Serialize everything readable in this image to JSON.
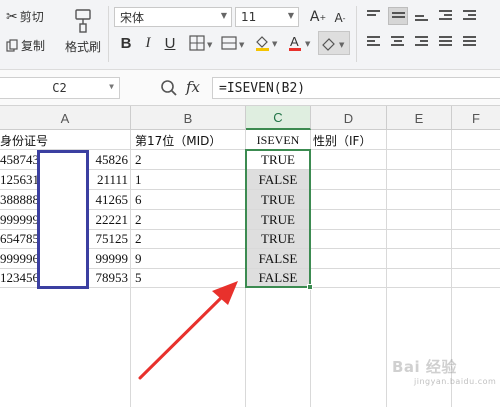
{
  "ribbon": {
    "cut_label": "剪切",
    "copy_label": "复制",
    "format_painter_label": "格式刷",
    "font_name": "宋体",
    "font_size": "11",
    "bold": "B",
    "italic": "I",
    "underline": "U"
  },
  "formula_bar": {
    "name_box": "C2",
    "fx": "fx",
    "formula": "=ISEVEN(B2)"
  },
  "columns": [
    "A",
    "B",
    "C",
    "D",
    "E",
    "F"
  ],
  "selected_column": "C",
  "table": {
    "headers": {
      "a": "身份证号",
      "b": "第17位（MID）",
      "c": "ISEVEN",
      "d": "性别（IF）"
    },
    "rows": [
      {
        "a_left": "458743",
        "a_right": "45826",
        "b": "2",
        "c": "TRUE"
      },
      {
        "a_left": "125631",
        "a_right": "21111",
        "b": "1",
        "c": "FALSE"
      },
      {
        "a_left": "388888",
        "a_right": "41265",
        "b": "6",
        "c": "TRUE"
      },
      {
        "a_left": "999999",
        "a_right": "22221",
        "b": "2",
        "c": "TRUE"
      },
      {
        "a_left": "654785",
        "a_right": "75125",
        "b": "2",
        "c": "TRUE"
      },
      {
        "a_left": "999996",
        "a_right": "99999",
        "b": "9",
        "c": "FALSE"
      },
      {
        "a_left": "123456",
        "a_right": "78953",
        "b": "5",
        "c": "FALSE"
      }
    ]
  },
  "watermark": "Bai 经验",
  "watermark_sub": "jingyan.baidu.com",
  "colors": {
    "selection": "#3c8b51",
    "mask_border": "#3b3fa1",
    "arrow": "#e8312c"
  }
}
